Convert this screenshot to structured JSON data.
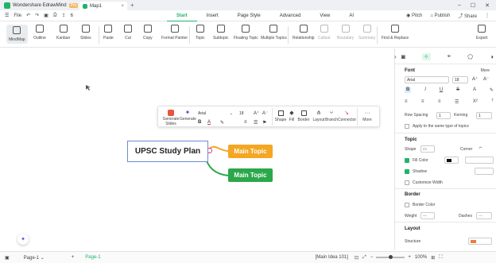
{
  "titlebar": {
    "app_name": "Wondershare EdrawMind",
    "pro_badge": "Pro",
    "doc_tab": "Map1",
    "close": "×",
    "new_tab": "+"
  },
  "menubar": {
    "file": "File",
    "badge_count": "6",
    "tabs": [
      "Start",
      "Insert",
      "Page Style",
      "Advanced",
      "View",
      "AI"
    ],
    "pitch": "Pitch",
    "publish": "Publish",
    "share": "Share"
  },
  "toolbar": {
    "views": [
      "MindMap",
      "Outline",
      "Kanban",
      "Slides"
    ],
    "clipboard": [
      "Paste",
      "Cut",
      "Copy",
      "Format Painter"
    ],
    "topics": [
      "Topic",
      "Subtopic",
      "Floating Topic",
      "Multiple Topics"
    ],
    "relations": [
      "Relationship",
      "Callout",
      "Boundary",
      "Summary"
    ],
    "find_replace": "Find & Replace",
    "export": "Export"
  },
  "canvas": {
    "main_topic": "UPSC Study Plan",
    "subtopics": [
      {
        "label": "Main Topic",
        "color": "#f5a623"
      },
      {
        "label": "Main Topic",
        "color": "#2ba84a"
      }
    ]
  },
  "floatbar": {
    "generate_slides": "Generate Slides",
    "generate": "Generate",
    "font": "Arial",
    "font_size": "18",
    "tools": [
      "Shape",
      "Fill",
      "Border",
      "Layout",
      "Branch",
      "Connector"
    ],
    "more": "More"
  },
  "rpanel": {
    "font_header": "Font",
    "more": "More",
    "font_name": "Arial",
    "font_size": "18",
    "row_spacing_label": "Row Spacing",
    "row_spacing_value": "1",
    "kerning_label": "Kerning",
    "kerning_value": "1",
    "apply_same": "Apply to the same type of topics",
    "topic_header": "Topic",
    "shape_label": "Shape",
    "corner_label": "Corner",
    "fill_color": "Fill Color",
    "shadow": "Shadow",
    "customize_width": "Customize Width",
    "border_header": "Border",
    "border_color": "Border Color",
    "weight_label": "Weight",
    "dashes_label": "Dashes",
    "layout_header": "Layout",
    "structure_label": "Structure"
  },
  "statusbar": {
    "page_dropdown": "Page-1",
    "page_tab": "Page-1",
    "main_idea": "[Main Idea 101]",
    "zoom": "100%"
  },
  "colors": {
    "accent": "#1fb46a",
    "main_border": "#6b8bd6",
    "orange_topic": "#f5a623",
    "green_topic": "#2ba84a"
  }
}
